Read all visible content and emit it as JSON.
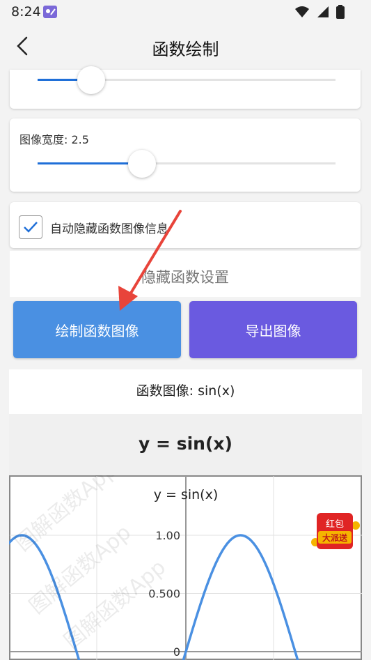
{
  "status": {
    "time": "8:24"
  },
  "header": {
    "title": "函数绘制"
  },
  "width_control": {
    "label": "图像宽度: 2.5",
    "value": 2.5,
    "fraction": 0.35
  },
  "top_slider": {
    "fraction": 0.18
  },
  "auto_hide": {
    "label": "自动隐藏函数图像信息",
    "checked": true
  },
  "hide_settings": {
    "label": "隐藏函数设置"
  },
  "buttons": {
    "draw": {
      "label": "绘制函数图像",
      "color": "#4a90e2"
    },
    "export": {
      "label": "导出图像",
      "color": "#6a5ae0"
    }
  },
  "plot": {
    "caption": "函数图像: sin(x)",
    "header_title": "y = sin(x)",
    "inner_title": "y = sin(x)",
    "watermark": "图解函数App"
  },
  "chart_data": {
    "type": "line",
    "title": "y = sin(x)",
    "function": "sin(x)",
    "xlim": [
      -5.1,
      4.9
    ],
    "ylim": [
      -0.02,
      1.6
    ],
    "y_ticks": [
      "1.00",
      "0.500",
      "0"
    ],
    "y_tick_values": [
      1.0,
      0.5,
      0.0
    ],
    "line_color": "#4a90e2",
    "grid": true
  },
  "overlay": {
    "redpacket_text_1": "红包",
    "redpacket_text_2": "大派送"
  }
}
